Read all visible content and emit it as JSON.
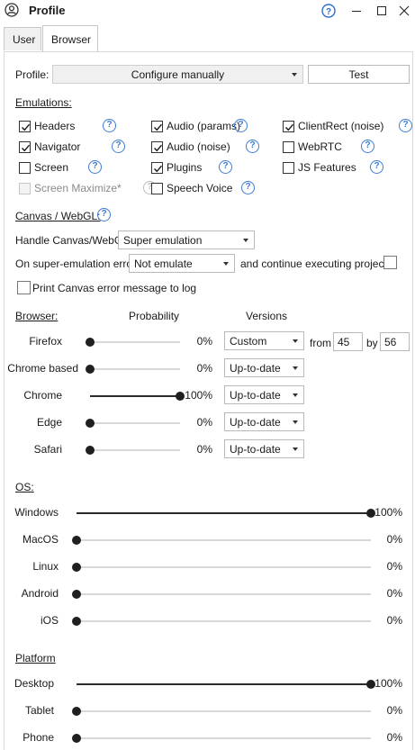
{
  "window": {
    "title": "Profile"
  },
  "tabs": [
    {
      "label": "User"
    },
    {
      "label": "Browser"
    }
  ],
  "profile": {
    "label": "Profile:",
    "value": "Configure manually",
    "test_label": "Test"
  },
  "emulations": {
    "heading": "Emulations:",
    "items": [
      {
        "label": "Headers",
        "checked": true,
        "disabled": false
      },
      {
        "label": "Audio (params)",
        "checked": true,
        "disabled": false
      },
      {
        "label": "ClientRect (noise)",
        "checked": true,
        "disabled": false
      },
      {
        "label": "Navigator",
        "checked": true,
        "disabled": false
      },
      {
        "label": "Audio (noise)",
        "checked": true,
        "disabled": false
      },
      {
        "label": "WebRTC",
        "checked": false,
        "disabled": false
      },
      {
        "label": "Screen",
        "checked": false,
        "disabled": false
      },
      {
        "label": "Plugins",
        "checked": true,
        "disabled": false
      },
      {
        "label": "JS Features",
        "checked": false,
        "disabled": false
      },
      {
        "label": "Screen Maximize*",
        "checked": false,
        "disabled": true
      },
      {
        "label": "Speech Voice",
        "checked": false,
        "disabled": false
      }
    ]
  },
  "canvas": {
    "heading": "Canvas / WebGL:",
    "handle_label": "Handle Canvas/WebGL",
    "handle_value": "Super emulation",
    "error_label": "On super-emulation error",
    "error_value": "Not emulate",
    "continue_label": "and continue executing project",
    "continue_checked": false,
    "print_label": "Print Canvas error message to log",
    "print_checked": false
  },
  "browser": {
    "heading": "Browser:",
    "probability_header": "Probability",
    "versions_header": "Versions",
    "from_label": "from",
    "by_label": "by",
    "from_value": "45",
    "by_value": "56",
    "items": [
      {
        "label": "Firefox",
        "percent": 0,
        "percent_text": "0%",
        "version": "Custom"
      },
      {
        "label": "Chrome based",
        "percent": 0,
        "percent_text": "0%",
        "version": "Up-to-date"
      },
      {
        "label": "Chrome",
        "percent": 100,
        "percent_text": "100%",
        "version": "Up-to-date"
      },
      {
        "label": "Edge",
        "percent": 0,
        "percent_text": "0%",
        "version": "Up-to-date"
      },
      {
        "label": "Safari",
        "percent": 0,
        "percent_text": "0%",
        "version": "Up-to-date"
      }
    ]
  },
  "os": {
    "heading": "OS:",
    "items": [
      {
        "label": "Windows",
        "percent": 100,
        "percent_text": "100%"
      },
      {
        "label": "MacOS",
        "percent": 0,
        "percent_text": "0%"
      },
      {
        "label": "Linux",
        "percent": 0,
        "percent_text": "0%"
      },
      {
        "label": "Android",
        "percent": 0,
        "percent_text": "0%"
      },
      {
        "label": "iOS",
        "percent": 0,
        "percent_text": "0%"
      }
    ]
  },
  "platform": {
    "heading": "Platform",
    "items": [
      {
        "label": "Desktop",
        "percent": 100,
        "percent_text": "100%"
      },
      {
        "label": "Tablet",
        "percent": 0,
        "percent_text": "0%"
      },
      {
        "label": "Phone",
        "percent": 0,
        "percent_text": "0%"
      }
    ]
  }
}
